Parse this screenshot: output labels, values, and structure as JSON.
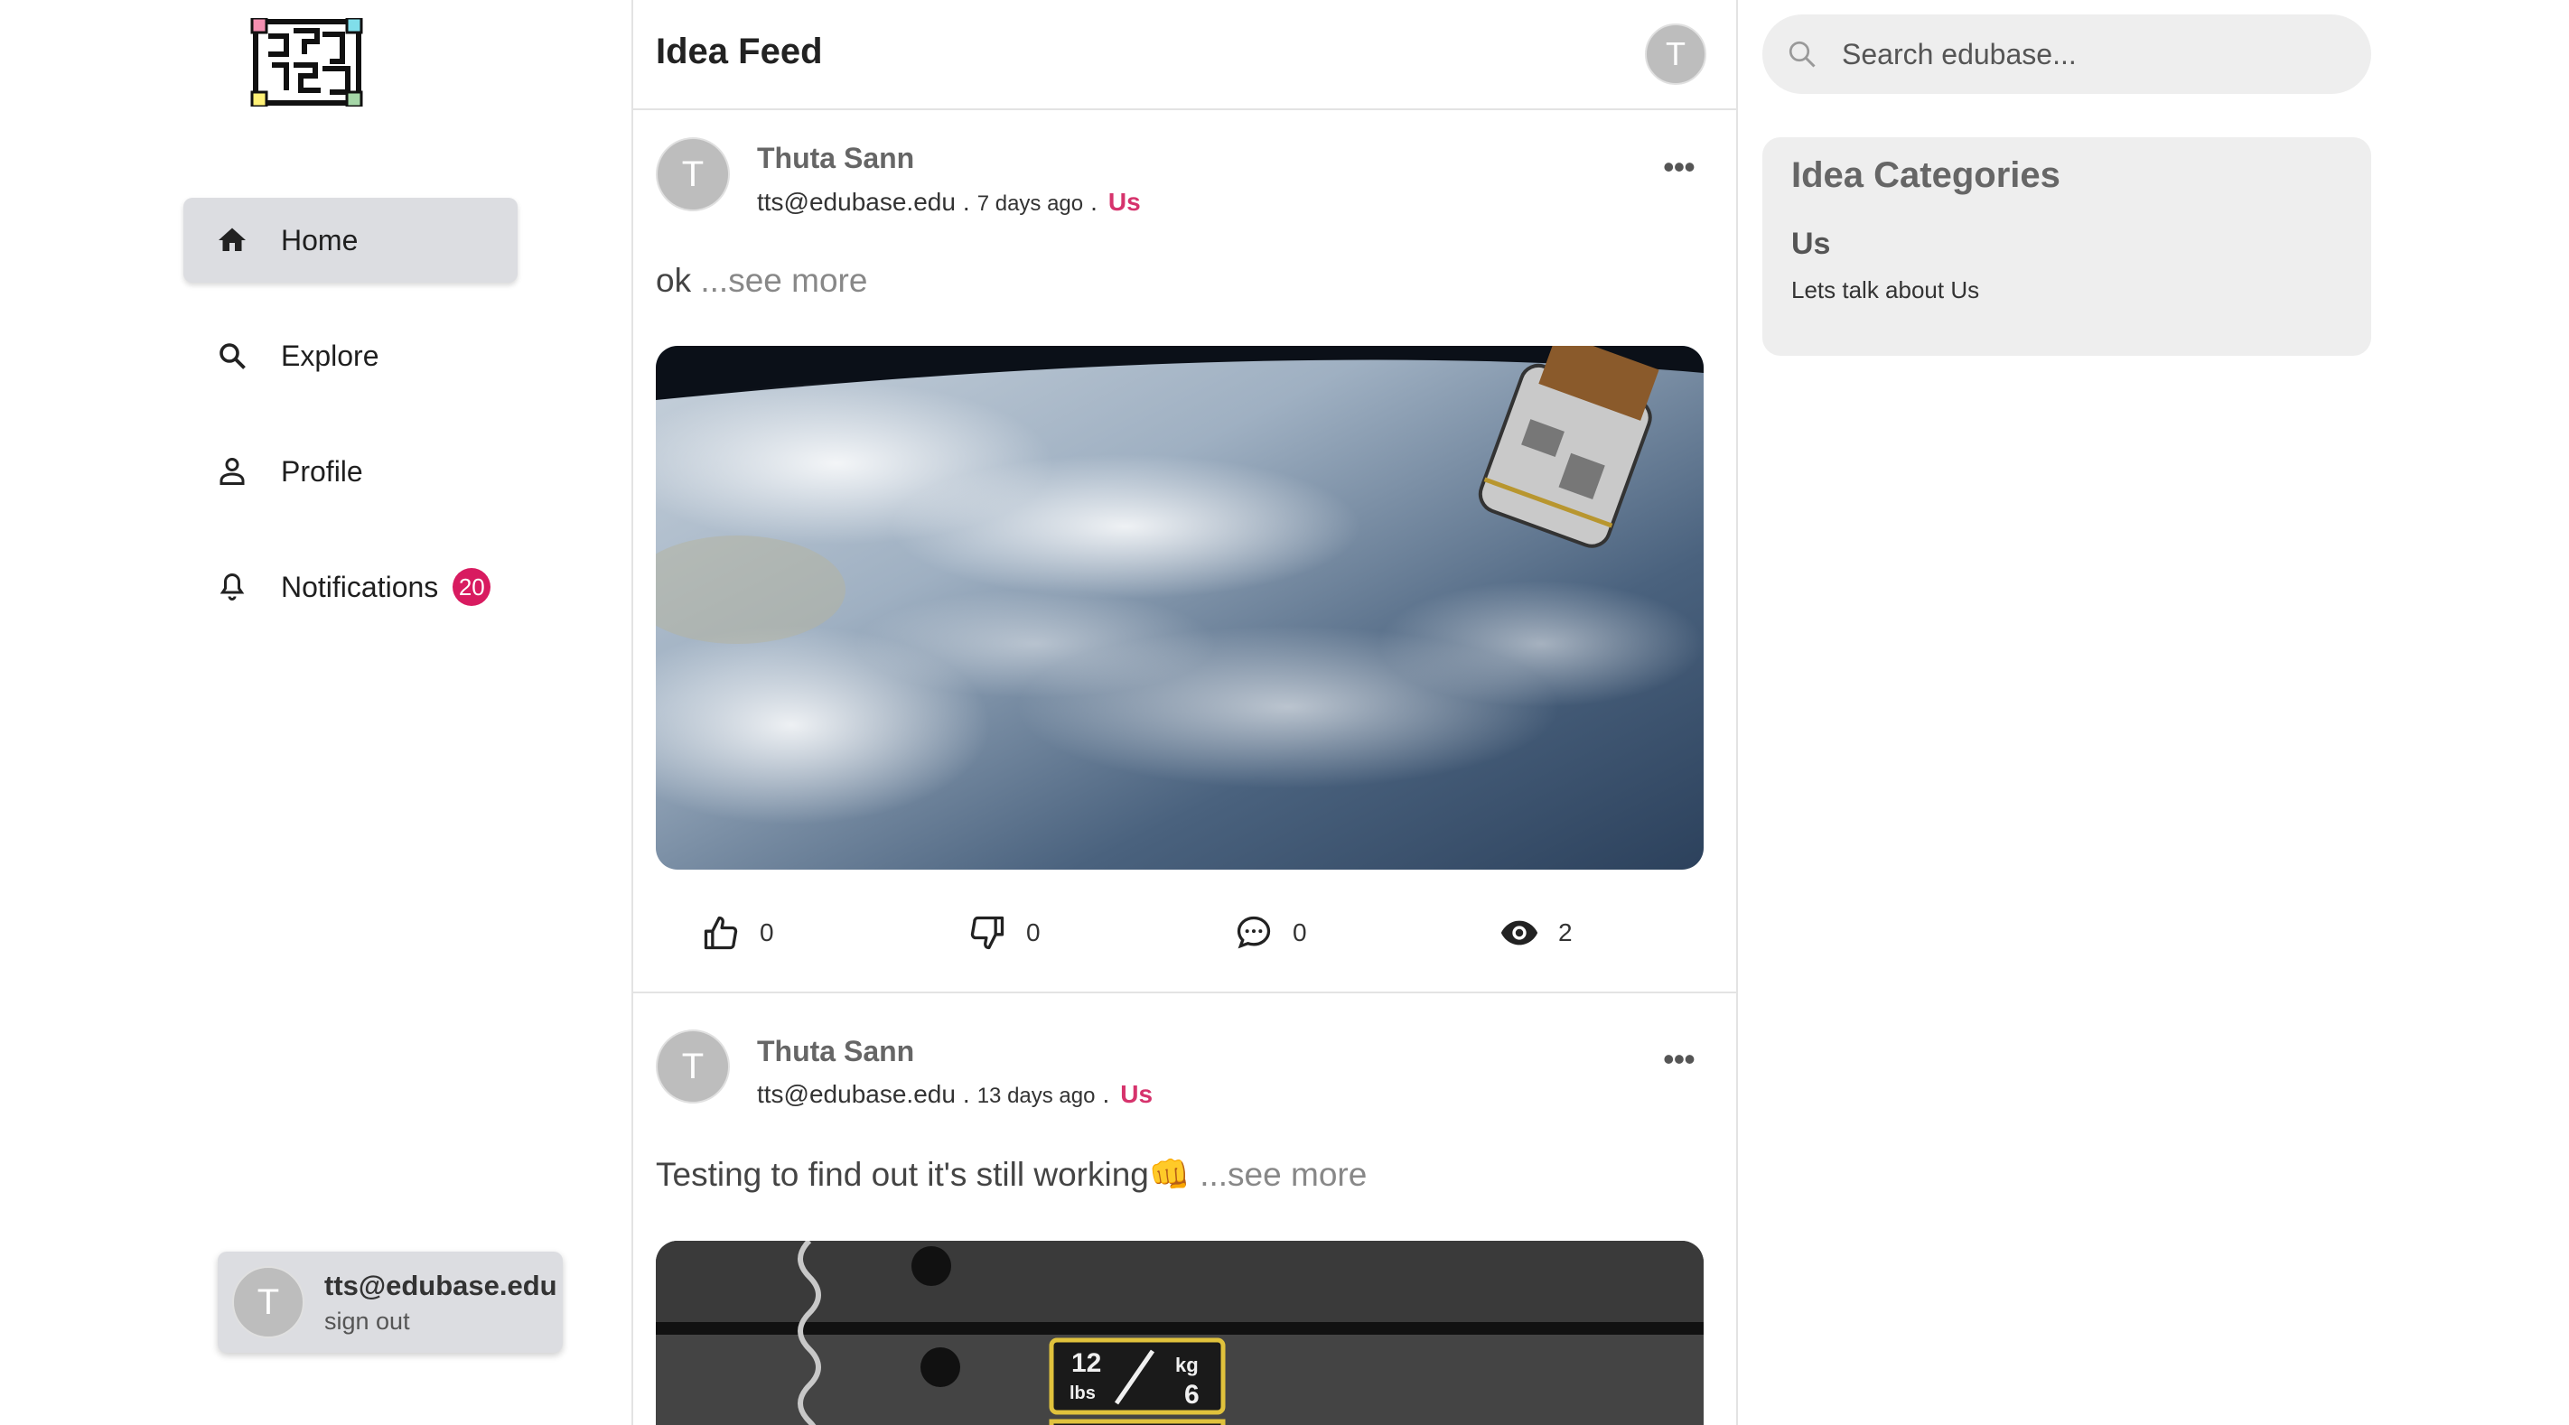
{
  "sidebar": {
    "nav": [
      {
        "label": "Home",
        "icon": "home-icon",
        "active": true
      },
      {
        "label": "Explore",
        "icon": "search-icon",
        "active": false
      },
      {
        "label": "Profile",
        "icon": "person-icon",
        "active": false
      },
      {
        "label": "Notifications",
        "icon": "bell-icon",
        "active": false,
        "badge": "20"
      }
    ],
    "user": {
      "avatar_letter": "T",
      "email": "tts@edubase.edu",
      "signout_label": "sign out"
    }
  },
  "feed": {
    "title": "Idea Feed",
    "header_avatar_letter": "T",
    "posts": [
      {
        "avatar_letter": "T",
        "author": "Thuta Sann",
        "email": "tts@edubase.edu",
        "time_ago": "7 days ago",
        "category": "Us",
        "text": "ok",
        "see_more": "...see more",
        "image_desc": "earth-from-space",
        "likes": "0",
        "dislikes": "0",
        "comments": "0",
        "views": "2"
      },
      {
        "avatar_letter": "T",
        "author": "Thuta Sann",
        "email": "tts@edubase.edu",
        "time_ago": "13 days ago",
        "category": "Us",
        "text": "Testing to find out it's still working👊",
        "see_more": "...see more",
        "image_desc": "weight-plates"
      }
    ],
    "more_icon": "more-horizontal-icon"
  },
  "right": {
    "search": {
      "placeholder": "Search edubase..."
    },
    "categories": {
      "title": "Idea Categories",
      "items": [
        {
          "name": "Us",
          "description": "Lets talk about Us"
        }
      ]
    }
  },
  "colors": {
    "accent": "#d6336c",
    "badge": "#d81b60",
    "active_nav": "#dcdde1",
    "panel": "#eeeeee"
  }
}
